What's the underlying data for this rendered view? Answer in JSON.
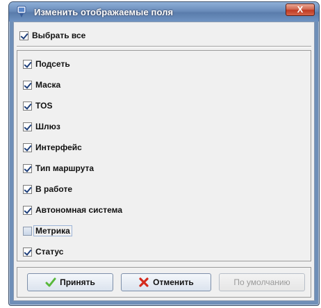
{
  "window": {
    "title": "Изменить отображаемые поля",
    "close_glyph": "X"
  },
  "select_all": {
    "label": "Выбрать все",
    "checked": true
  },
  "fields": [
    {
      "label": "Подсеть",
      "checked": true
    },
    {
      "label": "Маска",
      "checked": true
    },
    {
      "label": "TOS",
      "checked": true
    },
    {
      "label": "Шлюз",
      "checked": true
    },
    {
      "label": "Интерфейс",
      "checked": true
    },
    {
      "label": "Тип маршрута",
      "checked": true
    },
    {
      "label": "В работе",
      "checked": true
    },
    {
      "label": "Автономная система",
      "checked": true
    },
    {
      "label": "Метрика",
      "checked": false
    },
    {
      "label": "Статус",
      "checked": true
    }
  ],
  "buttons": {
    "accept": {
      "label": "Принять",
      "icon": "checkmark-icon"
    },
    "cancel": {
      "label": "Отменить",
      "icon": "x-icon"
    },
    "default": {
      "label": "По умолчанию",
      "enabled": false
    }
  },
  "colors": {
    "accept_icon": "#58b83a",
    "cancel_icon": "#d42a1c",
    "title_bar": "#6b8dbb"
  }
}
